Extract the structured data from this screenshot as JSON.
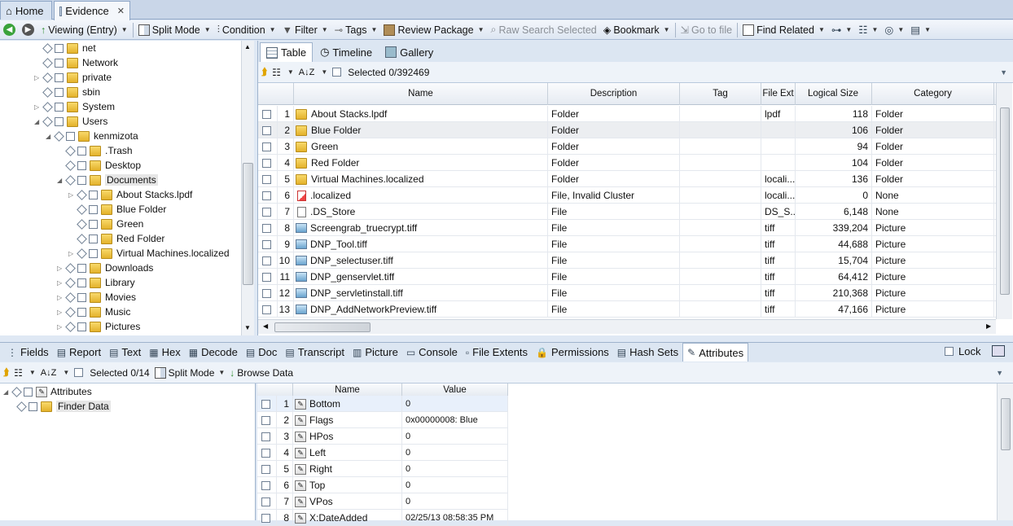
{
  "tabs": [
    {
      "label": "Home"
    },
    {
      "label": "Evidence",
      "close": "✕"
    }
  ],
  "toolbar": {
    "viewing": "Viewing (Entry)",
    "split_mode": "Split Mode",
    "condition": "Condition",
    "filter": "Filter",
    "tags": "Tags",
    "review_package": "Review Package",
    "raw_search": "Raw Search Selected",
    "bookmark": "Bookmark",
    "go_to_file": "Go to file",
    "find_related": "Find Related"
  },
  "tree": [
    {
      "label": "net",
      "indent": 0,
      "exp": ""
    },
    {
      "label": "Network",
      "indent": 0,
      "exp": ""
    },
    {
      "label": "private",
      "indent": 0,
      "exp": "▷"
    },
    {
      "label": "sbin",
      "indent": 0,
      "exp": ""
    },
    {
      "label": "System",
      "indent": 0,
      "exp": "▷"
    },
    {
      "label": "Users",
      "indent": 0,
      "exp": "◢"
    },
    {
      "label": "kenmizota",
      "indent": 1,
      "exp": "◢"
    },
    {
      "label": ".Trash",
      "indent": 2,
      "exp": ""
    },
    {
      "label": "Desktop",
      "indent": 2,
      "exp": ""
    },
    {
      "label": "Documents",
      "indent": 2,
      "exp": "◢",
      "selected": true
    },
    {
      "label": "About Stacks.lpdf",
      "indent": 3,
      "exp": "▷"
    },
    {
      "label": "Blue Folder",
      "indent": 3,
      "exp": ""
    },
    {
      "label": "Green",
      "indent": 3,
      "exp": ""
    },
    {
      "label": "Red Folder",
      "indent": 3,
      "exp": ""
    },
    {
      "label": "Virtual Machines.localized",
      "indent": 3,
      "exp": "▷"
    },
    {
      "label": "Downloads",
      "indent": 2,
      "exp": "▷"
    },
    {
      "label": "Library",
      "indent": 2,
      "exp": "▷"
    },
    {
      "label": "Movies",
      "indent": 2,
      "exp": "▷"
    },
    {
      "label": "Music",
      "indent": 2,
      "exp": "▷"
    },
    {
      "label": "Pictures",
      "indent": 2,
      "exp": "▷"
    }
  ],
  "view_tabs": {
    "table": "Table",
    "timeline": "Timeline",
    "gallery": "Gallery"
  },
  "selected_count": "Selected 0/392469",
  "grid": {
    "columns": [
      "Name",
      "Description",
      "Tag",
      "File Ext",
      "Logical Size",
      "Category"
    ],
    "rows": [
      {
        "n": "1",
        "name": "About Stacks.lpdf",
        "desc": "Folder",
        "tag": "",
        "ext": "lpdf",
        "size": "118",
        "cat": "Folder",
        "icon": "folder"
      },
      {
        "n": "2",
        "name": "Blue Folder",
        "desc": "Folder",
        "tag": "",
        "ext": "",
        "size": "106",
        "cat": "Folder",
        "icon": "folder",
        "highlight": true
      },
      {
        "n": "3",
        "name": "Green",
        "desc": "Folder",
        "tag": "",
        "ext": "",
        "size": "94",
        "cat": "Folder",
        "icon": "folder"
      },
      {
        "n": "4",
        "name": "Red Folder",
        "desc": "Folder",
        "tag": "",
        "ext": "",
        "size": "104",
        "cat": "Folder",
        "icon": "folder"
      },
      {
        "n": "5",
        "name": "Virtual Machines.localized",
        "desc": "Folder",
        "tag": "",
        "ext": "locali...",
        "size": "136",
        "cat": "Folder",
        "icon": "folder"
      },
      {
        "n": "6",
        "name": ".localized",
        "desc": "File, Invalid Cluster",
        "tag": "",
        "ext": "locali...",
        "size": "0",
        "cat": "None",
        "icon": "badfile"
      },
      {
        "n": "7",
        "name": ".DS_Store",
        "desc": "File",
        "tag": "",
        "ext": "DS_S...",
        "size": "6,148",
        "cat": "None",
        "icon": "file"
      },
      {
        "n": "8",
        "name": "Screengrab_truecrypt.tiff",
        "desc": "File",
        "tag": "",
        "ext": "tiff",
        "size": "339,204",
        "cat": "Picture",
        "icon": "picture"
      },
      {
        "n": "9",
        "name": "DNP_Tool.tiff",
        "desc": "File",
        "tag": "",
        "ext": "tiff",
        "size": "44,688",
        "cat": "Picture",
        "icon": "picture"
      },
      {
        "n": "10",
        "name": "DNP_selectuser.tiff",
        "desc": "File",
        "tag": "",
        "ext": "tiff",
        "size": "15,704",
        "cat": "Picture",
        "icon": "picture"
      },
      {
        "n": "11",
        "name": "DNP_genservlet.tiff",
        "desc": "File",
        "tag": "",
        "ext": "tiff",
        "size": "64,412",
        "cat": "Picture",
        "icon": "picture"
      },
      {
        "n": "12",
        "name": "DNP_servletinstall.tiff",
        "desc": "File",
        "tag": "",
        "ext": "tiff",
        "size": "210,368",
        "cat": "Picture",
        "icon": "picture"
      },
      {
        "n": "13",
        "name": "DNP_AddNetworkPreview.tiff",
        "desc": "File",
        "tag": "",
        "ext": "tiff",
        "size": "47,166",
        "cat": "Picture",
        "icon": "picture"
      }
    ]
  },
  "bottom_tabs": [
    "Fields",
    "Report",
    "Text",
    "Hex",
    "Decode",
    "Doc",
    "Transcript",
    "Picture",
    "Console",
    "File Extents",
    "Permissions",
    "Hash Sets",
    "Attributes"
  ],
  "lock_label": "Lock",
  "bottom_toolbar": {
    "selected": "Selected 0/14",
    "split_mode": "Split Mode",
    "browse_data": "Browse Data"
  },
  "attr_tree": [
    {
      "label": "Attributes"
    },
    {
      "label": "Finder Data"
    }
  ],
  "attr_grid": {
    "columns": [
      "Name",
      "Value"
    ],
    "rows": [
      {
        "n": "1",
        "name": "Bottom",
        "value": "0"
      },
      {
        "n": "2",
        "name": "Flags",
        "value": "0x00000008: Blue"
      },
      {
        "n": "3",
        "name": "HPos",
        "value": "0"
      },
      {
        "n": "4",
        "name": "Left",
        "value": "0"
      },
      {
        "n": "5",
        "name": "Right",
        "value": "0"
      },
      {
        "n": "6",
        "name": "Top",
        "value": "0"
      },
      {
        "n": "7",
        "name": "VPos",
        "value": "0"
      },
      {
        "n": "8",
        "name": "X:DateAdded",
        "value": "02/25/13 08:58:35 PM"
      }
    ]
  }
}
